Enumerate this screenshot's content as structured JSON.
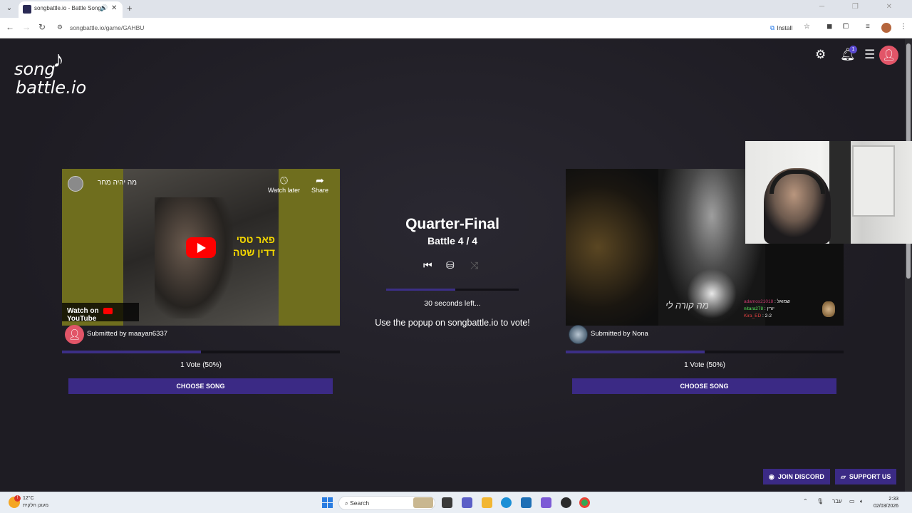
{
  "browser": {
    "tab_title": "songbattle.io - Battle Song",
    "tab_audio_icon": "speaker-icon",
    "url": "songbattle.io/game/GAHBU",
    "install_label": "Install"
  },
  "site": {
    "logo_song": "song",
    "logo_battle": "battle.io",
    "notification_count": "1"
  },
  "left_song": {
    "video_title": "מה יהיה מחר",
    "cover_text_line1": "פאר טסי",
    "cover_text_line2": "דדין שטה",
    "watch_later": "Watch later",
    "share": "Share",
    "watch_on": "Watch on",
    "youtube": "YouTube",
    "submitted_by": "Submitted by maayan6337",
    "vote_fraction": 0.5,
    "vote_label": "1 Vote (50%)",
    "choose_label": "CHOOSE SONG"
  },
  "right_song": {
    "cover_title": "מה קורה לי",
    "submitted_by": "Submitted by Nona",
    "vote_fraction": 0.5,
    "vote_label": "1 Vote (50%)",
    "choose_label": "CHOOSE SONG",
    "chat": [
      {
        "user": "adamos21018",
        "message": "שמואל"
      },
      {
        "user": "nitara278",
        "message": "יורין"
      },
      {
        "user": "Kira_ED",
        "message": "2-2"
      }
    ]
  },
  "battle": {
    "round": "Quarter-Final",
    "battle_label": "Battle 4 / 4",
    "time_fraction": 0.52,
    "seconds_left": "30 seconds left...",
    "popup_msg": "Use the popup on songbattle.io to vote!"
  },
  "footer": {
    "discord_label": "JOIN DISCORD",
    "support_label": "SUPPORT US"
  },
  "taskbar": {
    "temperature": "12°C",
    "weather_desc": "מעונן חלקית",
    "search_label": "Search",
    "language": "עבר",
    "time": "2:33",
    "date": "02/03/2026"
  }
}
